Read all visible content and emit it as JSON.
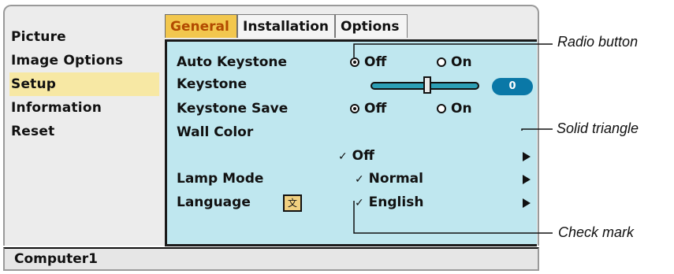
{
  "menu": {
    "items": [
      {
        "label": "Picture"
      },
      {
        "label": "Image Options"
      },
      {
        "label": "Setup",
        "selected": true
      },
      {
        "label": "Information"
      },
      {
        "label": "Reset"
      }
    ]
  },
  "tabs": [
    {
      "label": "General",
      "active": true
    },
    {
      "label": "Installation"
    },
    {
      "label": "Options"
    }
  ],
  "settings": {
    "auto_keystone": {
      "label": "Auto Keystone",
      "options": [
        "Off",
        "On"
      ],
      "selected": "Off"
    },
    "keystone": {
      "label": "Keystone",
      "value": "0"
    },
    "keystone_save": {
      "label": "Keystone Save",
      "options": [
        "Off",
        "On"
      ],
      "selected": "Off"
    },
    "wall_color": {
      "label": "Wall Color",
      "value": "Off"
    },
    "lamp_mode": {
      "label": "Lamp Mode",
      "value": "Normal"
    },
    "language": {
      "label": "Language",
      "value": "English"
    }
  },
  "status": {
    "source": "Computer1"
  },
  "callouts": {
    "radio": "Radio button",
    "triangle": "Solid triangle",
    "check": "Check mark"
  },
  "colors": {
    "panel_bg": "#bfe7ef",
    "active_tab": "#f2c74e",
    "selected_menu": "#f7e8a4",
    "slider_value_bg": "#0a78a7"
  }
}
